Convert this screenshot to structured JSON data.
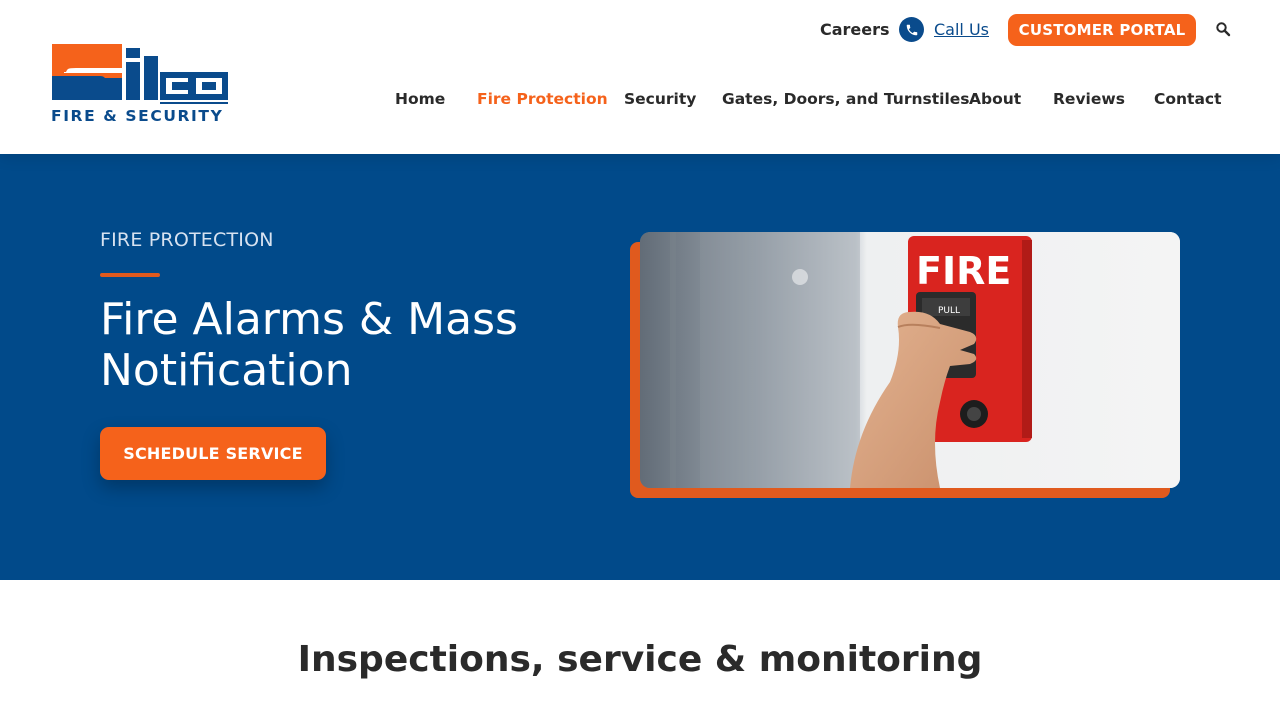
{
  "brand": {
    "logo_text": "Silco",
    "tagline": "FIRE & SECURITY",
    "colors": {
      "orange": "#f5621b",
      "blue": "#014a8a",
      "logo_blue": "#0a4b8c"
    }
  },
  "topbar": {
    "careers": "Careers",
    "call_us": "Call Us",
    "portal": "CUSTOMER PORTAL",
    "phone_icon": "phone-icon",
    "search_icon": "search-icon"
  },
  "nav": {
    "items": [
      {
        "label": "Home",
        "active": false
      },
      {
        "label": "Fire Protection",
        "active": true
      },
      {
        "label": "Security",
        "active": false
      },
      {
        "label": "Gates, Doors, and Turnstiles",
        "active": false
      },
      {
        "label": "About",
        "active": false
      },
      {
        "label": "Reviews",
        "active": false
      },
      {
        "label": "Contact",
        "active": false
      }
    ]
  },
  "hero": {
    "eyebrow": "FIRE PROTECTION",
    "title": "Fire Alarms & Mass Notification",
    "cta": "SCHEDULE SERVICE",
    "image_alt": "Hand pulling a red fire alarm pull station",
    "image_sign": "FIRE",
    "image_pull": "PULL"
  },
  "section": {
    "title": "Inspections, service & monitoring"
  }
}
